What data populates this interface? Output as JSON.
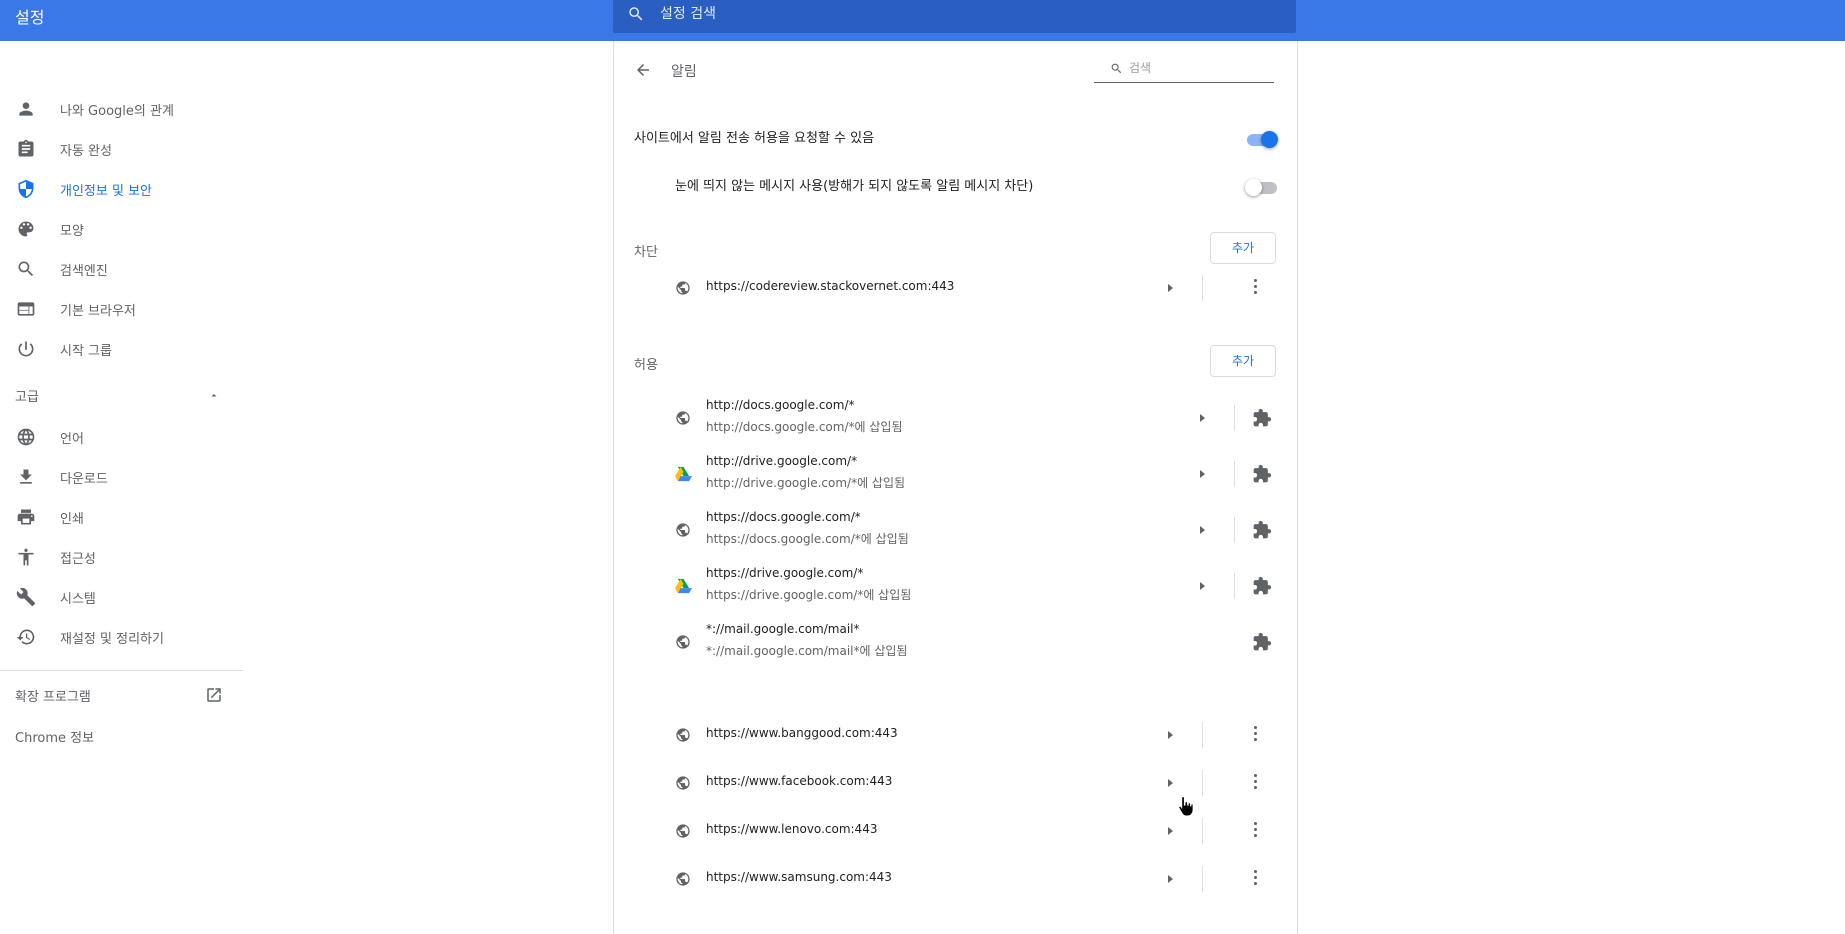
{
  "app": {
    "title": "설정",
    "search_placeholder": "설정 검색"
  },
  "sidebar": {
    "items": [
      {
        "label": "나와 Google의 관계",
        "icon": "person-icon"
      },
      {
        "label": "자동 완성",
        "icon": "clipboard-icon"
      },
      {
        "label": "개인정보 및 보안",
        "icon": "shield-icon",
        "active": true
      },
      {
        "label": "모양",
        "icon": "palette-icon"
      },
      {
        "label": "검색엔진",
        "icon": "search-icon"
      },
      {
        "label": "기본 브라우저",
        "icon": "browser-icon"
      },
      {
        "label": "시작 그룹",
        "icon": "power-icon"
      }
    ],
    "advanced_label": "고급",
    "advanced_items": [
      {
        "label": "언어",
        "icon": "globe-icon"
      },
      {
        "label": "다운로드",
        "icon": "download-icon"
      },
      {
        "label": "인쇄",
        "icon": "print-icon"
      },
      {
        "label": "접근성",
        "icon": "accessibility-icon"
      },
      {
        "label": "시스템",
        "icon": "wrench-icon"
      },
      {
        "label": "재설정 및 정리하기",
        "icon": "restore-icon"
      }
    ],
    "extensions_label": "확장 프로그램",
    "about_label": "Chrome 정보"
  },
  "page": {
    "title": "알림",
    "search_placeholder": "검색",
    "ask_label": "사이트에서 알림 전송 허용을 요청할 수 있음",
    "ask_enabled": true,
    "quiet_label": "눈에 띄지 않는 메시지 사용(방해가 되지 않도록 알림 메시지 차단)",
    "quiet_enabled": false,
    "block_label": "차단",
    "allow_label": "허용",
    "add_label": "추가"
  },
  "blocked_sites": [
    {
      "url": "https://codereview.stackovernet.com:443"
    }
  ],
  "allowed_sites": [
    {
      "url": "http://docs.google.com/*",
      "sub": "http://docs.google.com/*에 삽입됨",
      "icon": "globe-icon",
      "action": "extension"
    },
    {
      "url": "http://drive.google.com/*",
      "sub": "http://drive.google.com/*에 삽입됨",
      "icon": "drive-icon",
      "action": "extension"
    },
    {
      "url": "https://docs.google.com/*",
      "sub": "https://docs.google.com/*에 삽입됨",
      "icon": "globe-icon",
      "action": "extension"
    },
    {
      "url": "https://drive.google.com/*",
      "sub": "https://drive.google.com/*에 삽입됨",
      "icon": "drive-icon",
      "action": "extension"
    },
    {
      "url": "*://mail.google.com/mail*",
      "sub": "*://mail.google.com/mail*에 삽입됨",
      "icon": "globe-icon",
      "action": "extension"
    },
    {
      "url": "https://www.banggood.com:443",
      "icon": "globe-icon",
      "action": "menu"
    },
    {
      "url": "https://www.facebook.com:443",
      "icon": "globe-icon",
      "action": "menu"
    },
    {
      "url": "https://www.lenovo.com:443",
      "icon": "globe-icon",
      "action": "menu"
    },
    {
      "url": "https://www.samsung.com:443",
      "icon": "globe-icon",
      "action": "menu"
    }
  ],
  "colors": {
    "header": "#3b78e7",
    "search": "#2a5fc1",
    "accent": "#1a73e8"
  }
}
